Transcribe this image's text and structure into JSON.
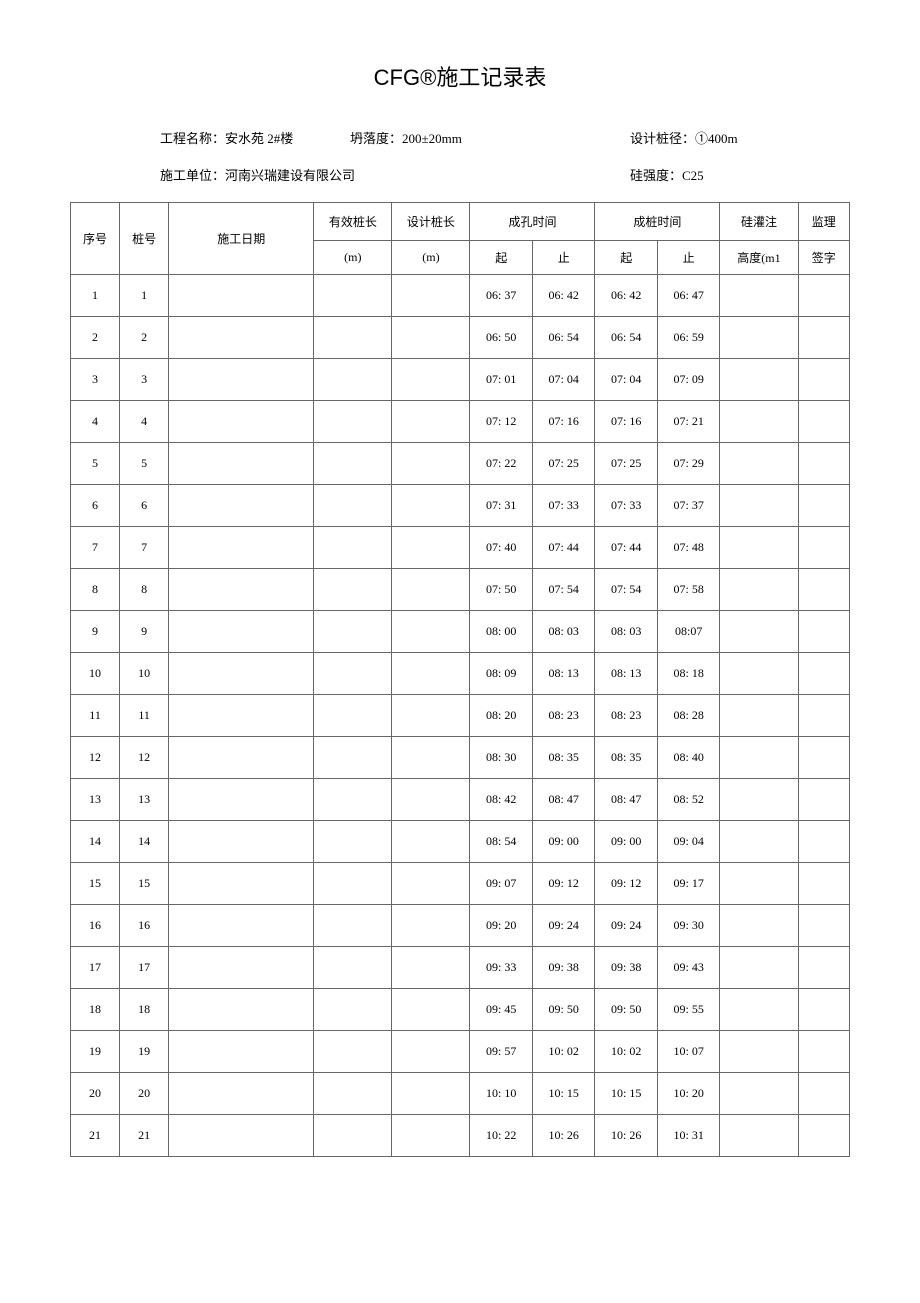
{
  "title": "CFG®施工记录表",
  "meta": {
    "label_project": "工程名称：",
    "project": "安水苑 2#楼",
    "label_slump": "坍落度：",
    "slump": "200±20mm",
    "label_design_dia": "设计桩径：",
    "design_dia": "①400m",
    "label_contractor": "施工单位：",
    "contractor": "河南兴瑞建设有限公司",
    "label_strength": "硅强度：",
    "strength": "C25"
  },
  "headers": {
    "seq": "序号",
    "pile": "桩号",
    "date": "施工日期",
    "efflen": "有效桩长",
    "deslen": "设计桩长",
    "hole_time": "成孔时间",
    "pile_time": "成桩时间",
    "pour": "硅灌注",
    "sign": "监理",
    "unit_m": "(m)",
    "start": "起",
    "stop": "止",
    "height": "高度(m1",
    "signature": "签字"
  },
  "rows": [
    {
      "seq": "1",
      "pile": "1",
      "hs": "06: 37",
      "he": "06: 42",
      "ps": "06: 42",
      "pe": "06: 47"
    },
    {
      "seq": "2",
      "pile": "2",
      "hs": "06: 50",
      "he": "06: 54",
      "ps": "06: 54",
      "pe": "06: 59"
    },
    {
      "seq": "3",
      "pile": "3",
      "hs": "07: 01",
      "he": "07: 04",
      "ps": "07: 04",
      "pe": "07: 09"
    },
    {
      "seq": "4",
      "pile": "4",
      "hs": "07: 12",
      "he": "07: 16",
      "ps": "07: 16",
      "pe": "07: 21"
    },
    {
      "seq": "5",
      "pile": "5",
      "hs": "07: 22",
      "he": "07: 25",
      "ps": "07: 25",
      "pe": "07: 29"
    },
    {
      "seq": "6",
      "pile": "6",
      "hs": "07: 31",
      "he": "07: 33",
      "ps": "07: 33",
      "pe": "07: 37"
    },
    {
      "seq": "7",
      "pile": "7",
      "hs": "07: 40",
      "he": "07: 44",
      "ps": "07: 44",
      "pe": "07: 48"
    },
    {
      "seq": "8",
      "pile": "8",
      "hs": "07: 50",
      "he": "07: 54",
      "ps": "07: 54",
      "pe": "07: 58"
    },
    {
      "seq": "9",
      "pile": "9",
      "hs": "08: 00",
      "he": "08: 03",
      "ps": "08: 03",
      "pe": "08:07"
    },
    {
      "seq": "10",
      "pile": "10",
      "hs": "08: 09",
      "he": "08: 13",
      "ps": "08: 13",
      "pe": "08: 18"
    },
    {
      "seq": "11",
      "pile": "11",
      "hs": "08: 20",
      "he": "08: 23",
      "ps": "08: 23",
      "pe": "08: 28"
    },
    {
      "seq": "12",
      "pile": "12",
      "hs": "08: 30",
      "he": "08: 35",
      "ps": "08: 35",
      "pe": "08: 40"
    },
    {
      "seq": "13",
      "pile": "13",
      "hs": "08: 42",
      "he": "08: 47",
      "ps": "08: 47",
      "pe": "08: 52"
    },
    {
      "seq": "14",
      "pile": "14",
      "hs": "08: 54",
      "he": "09: 00",
      "ps": "09: 00",
      "pe": "09: 04"
    },
    {
      "seq": "15",
      "pile": "15",
      "hs": "09: 07",
      "he": "09: 12",
      "ps": "09: 12",
      "pe": "09: 17"
    },
    {
      "seq": "16",
      "pile": "16",
      "hs": "09: 20",
      "he": "09: 24",
      "ps": "09: 24",
      "pe": "09: 30"
    },
    {
      "seq": "17",
      "pile": "17",
      "hs": "09: 33",
      "he": "09: 38",
      "ps": "09: 38",
      "pe": "09: 43"
    },
    {
      "seq": "18",
      "pile": "18",
      "hs": "09: 45",
      "he": "09: 50",
      "ps": "09: 50",
      "pe": "09: 55"
    },
    {
      "seq": "19",
      "pile": "19",
      "hs": "09: 57",
      "he": "10: 02",
      "ps": "10: 02",
      "pe": "10: 07"
    },
    {
      "seq": "20",
      "pile": "20",
      "hs": "10: 10",
      "he": "10: 15",
      "ps": "10: 15",
      "pe": "10: 20"
    },
    {
      "seq": "21",
      "pile": "21",
      "hs": "10: 22",
      "he": "10: 26",
      "ps": "10: 26",
      "pe": "10: 31"
    }
  ]
}
